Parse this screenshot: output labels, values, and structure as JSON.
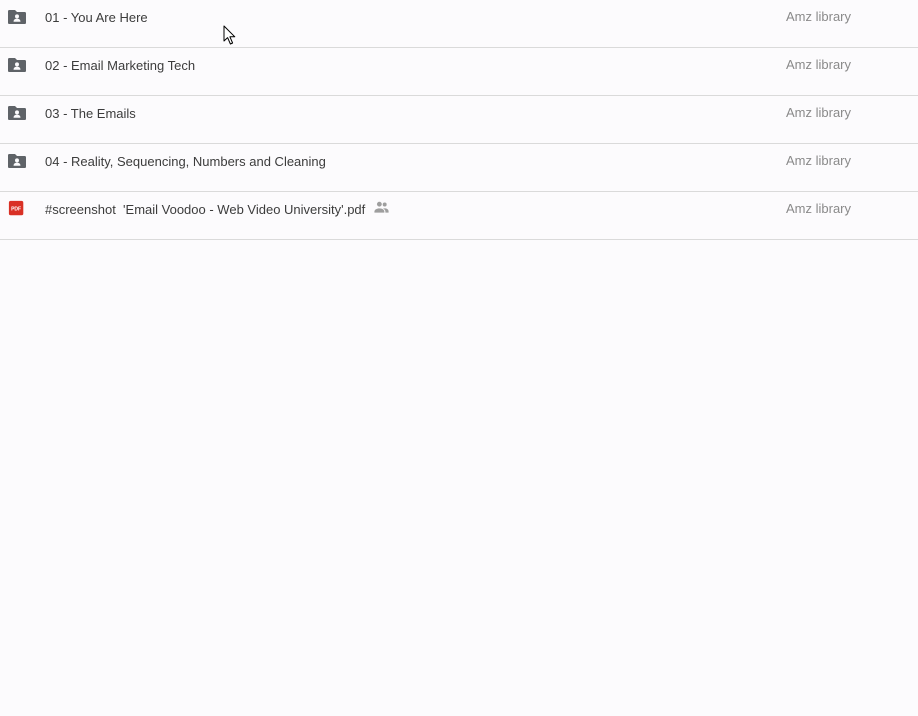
{
  "files": [
    {
      "name": "01 - You Are Here",
      "owner": "Amz library",
      "type": "shared-folder"
    },
    {
      "name": "02 - Email Marketing Tech",
      "owner": "Amz library",
      "type": "shared-folder"
    },
    {
      "name": "03 - The Emails",
      "owner": "Amz library",
      "type": "shared-folder"
    },
    {
      "name": "04 - Reality, Sequencing, Numbers and Cleaning",
      "owner": "Amz library",
      "type": "shared-folder"
    },
    {
      "name": "#screenshot  'Email Voodoo - Web Video University'.pdf",
      "owner": "Amz library",
      "type": "pdf",
      "shared": true,
      "icon_label": "PDF"
    }
  ],
  "colors": {
    "folder_icon": "#5f6368",
    "pdf_icon": "#d93025",
    "shared_icon": "#9e9e9e",
    "divider": "#dadada"
  }
}
